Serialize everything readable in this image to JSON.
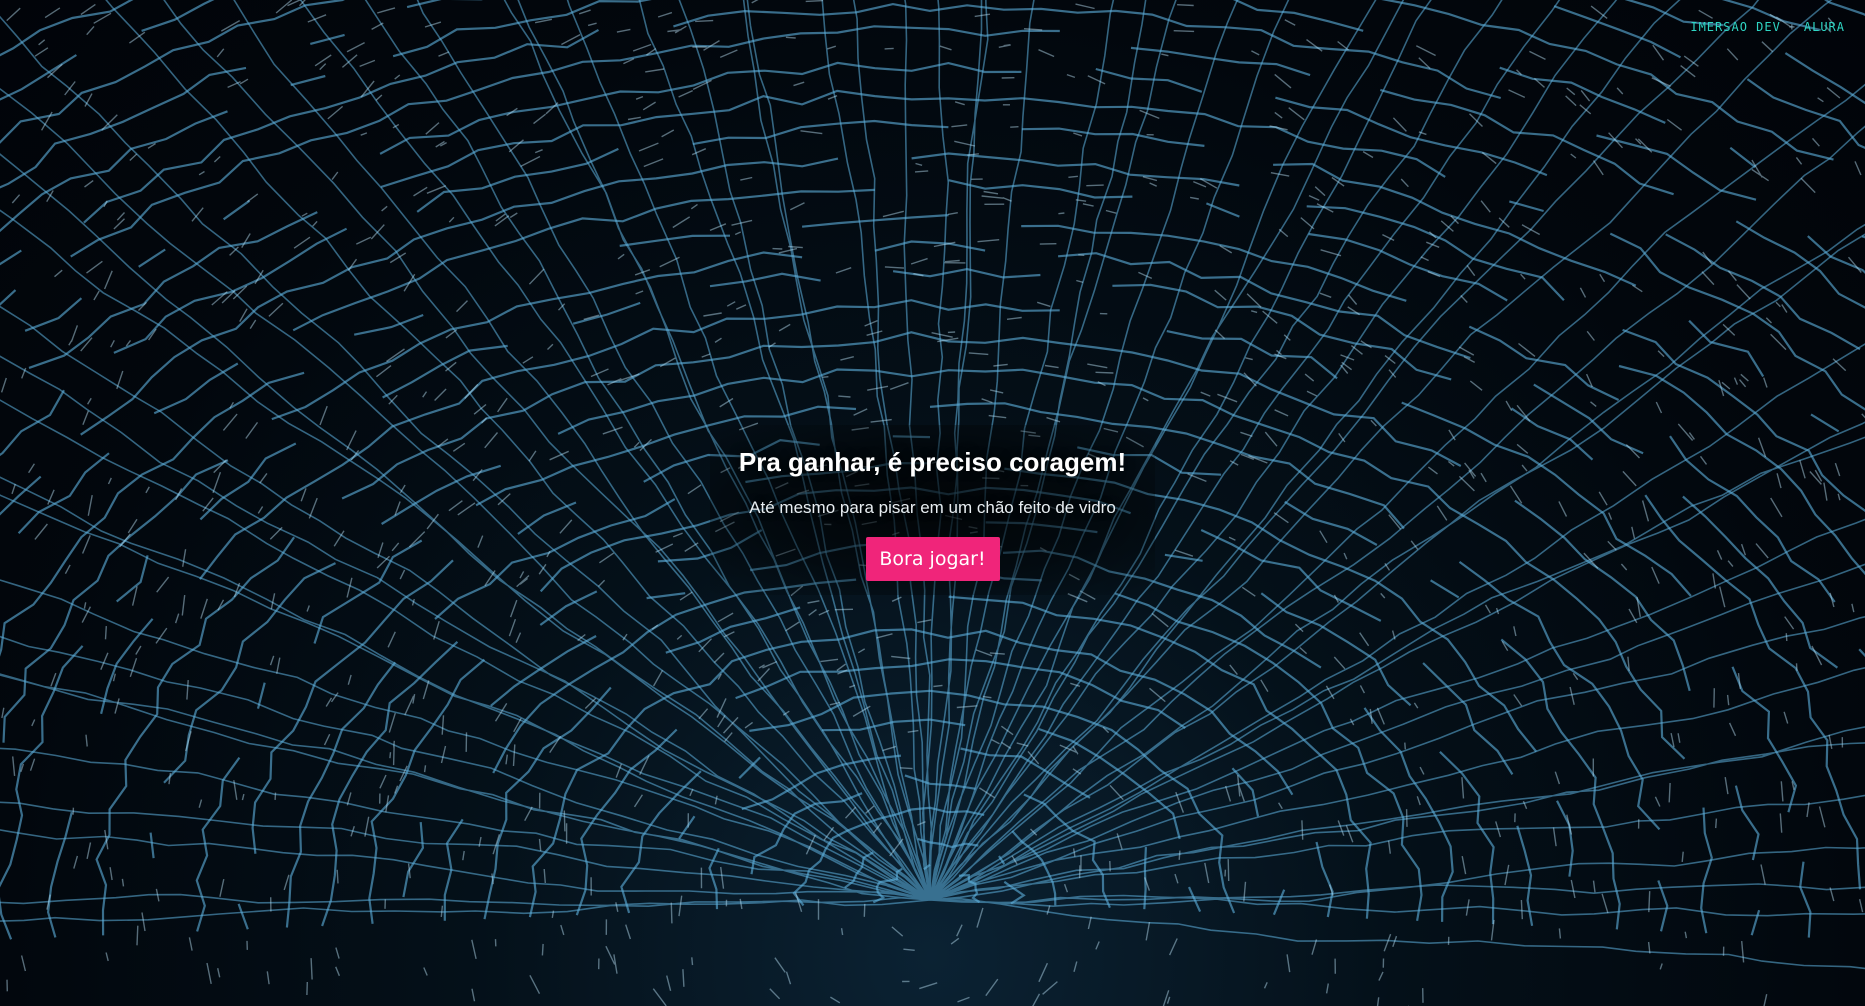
{
  "brand": {
    "imersao_label": "IMERSAO DEV",
    "separator": "+",
    "alura_label": "ALURA"
  },
  "hero": {
    "title": "Pra ganhar, é preciso coragem!",
    "subtitle": "Até mesmo para pisar em um chão feito de vidro",
    "button_label": "Bora jogar!"
  },
  "colors": {
    "background": "#02080f",
    "glass_crack": "#5fb3e0",
    "button": "#f0257a",
    "brand_accent": "#2fd6c4"
  }
}
